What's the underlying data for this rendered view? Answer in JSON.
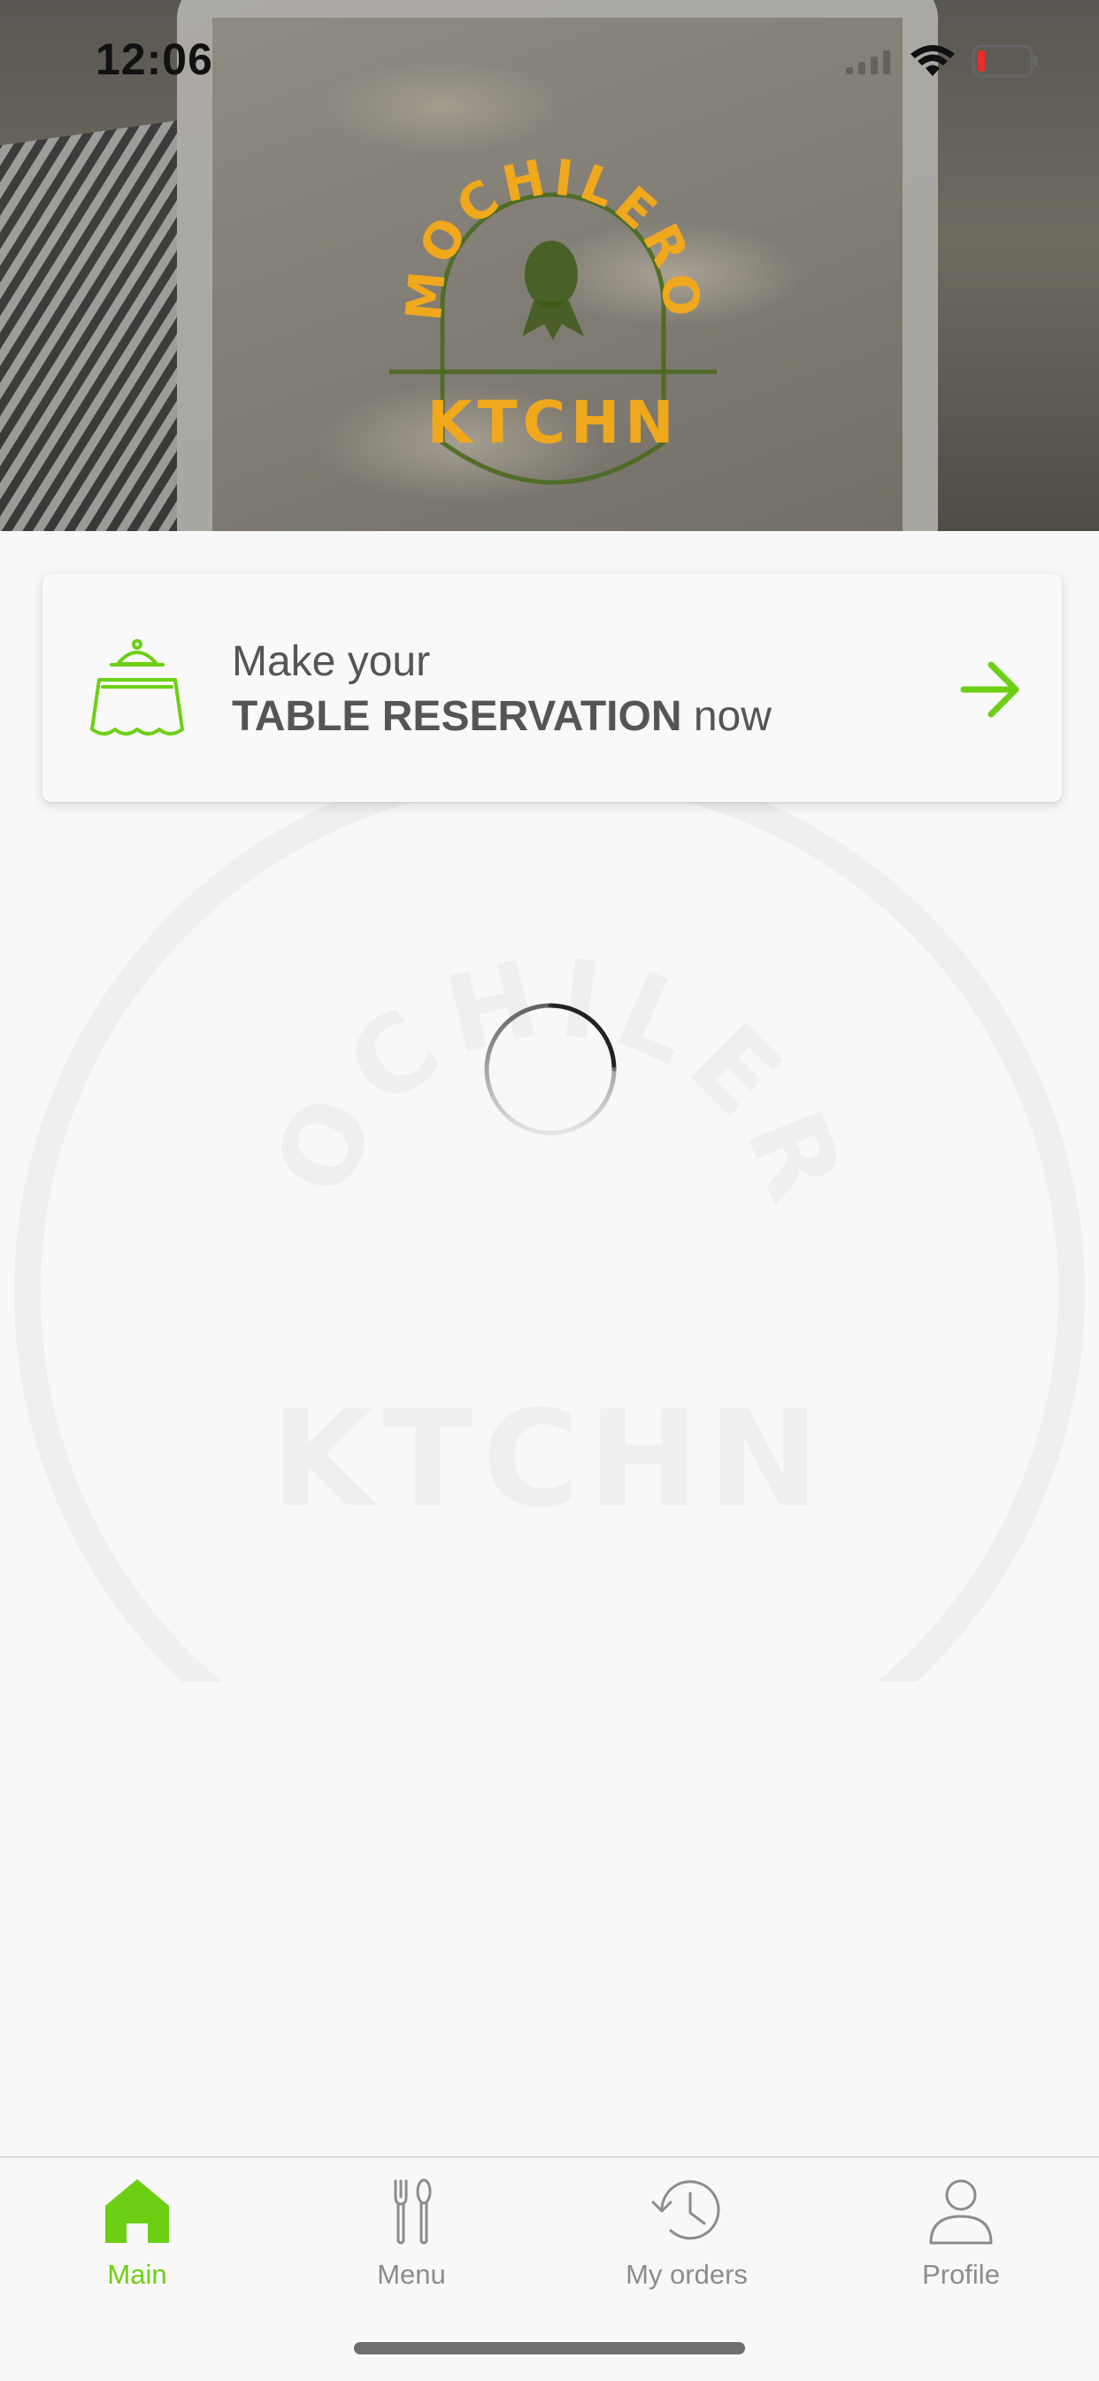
{
  "status_bar": {
    "time": "12:06"
  },
  "brand": {
    "top_word": "MOCHILERO",
    "bottom_word": "KTCHN"
  },
  "reservation_card": {
    "line1": "Make your",
    "line2_strong": "TABLE RESERVATION",
    "line2_rest": " now",
    "icon": "table-service-icon",
    "action_icon": "arrow-right-icon"
  },
  "loading": {
    "icon": "spinner-icon"
  },
  "tab_bar": {
    "tabs": [
      {
        "label": "Main",
        "icon": "home-icon",
        "active": true
      },
      {
        "label": "Menu",
        "icon": "cutlery-icon",
        "active": false
      },
      {
        "label": "My orders",
        "icon": "history-icon",
        "active": false
      },
      {
        "label": "Profile",
        "icon": "person-icon",
        "active": false
      }
    ]
  },
  "colors": {
    "accent": "#6ccf14",
    "logo_yellow": "#f0a81d",
    "logo_green": "#4a6a1e",
    "text": "#555555",
    "inactive": "#8c8c8c"
  }
}
